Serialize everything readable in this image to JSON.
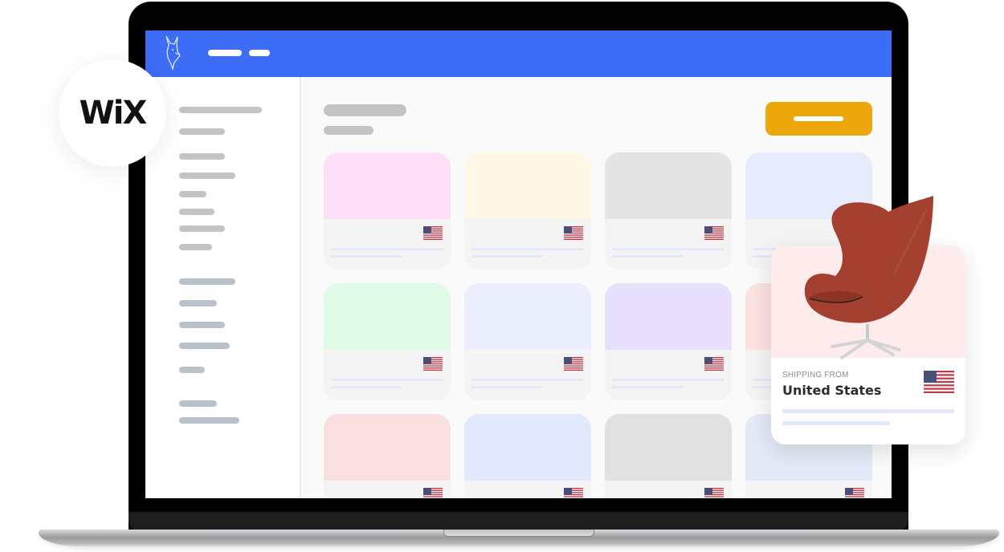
{
  "header": {
    "brand_icon": "llama-logo-icon",
    "nav_items": [
      "nav-placeholder-1",
      "nav-placeholder-2"
    ],
    "color": "#3d6cf7"
  },
  "wix_badge": {
    "text": "WiX",
    "icon": "wix-logo-icon"
  },
  "sidebar": {
    "group_1_count": 8,
    "group_2_count": 5,
    "group_3_count": 2
  },
  "main": {
    "primary_button": {
      "icon": "add-bar-icon",
      "color": "#eca80a"
    },
    "cards": [
      {
        "color": "#fde0f7",
        "flag": "us-flag-icon"
      },
      {
        "color": "#fff7e7",
        "flag": "us-flag-icon"
      },
      {
        "color": "#e4e4e4",
        "flag": "us-flag-icon"
      },
      {
        "color": "#e7ecfd",
        "flag": "us-flag-icon"
      },
      {
        "color": "#e0fbe8",
        "flag": "us-flag-icon"
      },
      {
        "color": "#ebeffd",
        "flag": "us-flag-icon"
      },
      {
        "color": "#e8e1fd",
        "flag": "us-flag-icon"
      },
      {
        "color": "#fbe1e0",
        "flag": "us-flag-icon"
      },
      {
        "color": "#f9dfe0",
        "flag": "us-flag-icon"
      },
      {
        "color": "#e2e9fd",
        "flag": "us-flag-icon"
      },
      {
        "color": "#e1e1e1",
        "flag": "us-flag-icon"
      },
      {
        "color": "#e3e9f7",
        "flag": "us-flag-icon"
      }
    ]
  },
  "product_card": {
    "shipping_label": "SHIPPING FROM",
    "country": "United States",
    "image": "egg-chair-image",
    "flag": "us-flag-icon"
  }
}
